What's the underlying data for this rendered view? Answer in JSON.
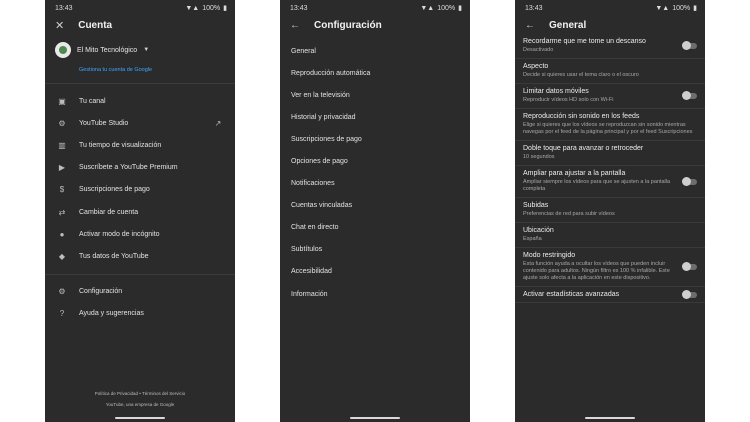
{
  "status": {
    "time": "13:43",
    "battery": "100%"
  },
  "panel1": {
    "title": "Cuenta",
    "account_name": "El Mito Tecnológico",
    "manage_link": "Gestiona tu cuenta de Google",
    "items": [
      {
        "label": "Tu canal",
        "icon": "person-icon"
      },
      {
        "label": "YouTube Studio",
        "icon": "gear-icon"
      },
      {
        "label": "Tu tiempo de visualización",
        "icon": "bar-chart-icon"
      },
      {
        "label": "Suscríbete a YouTube Premium",
        "icon": "youtube-icon"
      },
      {
        "label": "Suscripciones de pago",
        "icon": "dollar-icon"
      },
      {
        "label": "Cambiar de cuenta",
        "icon": "switch-account-icon"
      },
      {
        "label": "Activar modo de incógnito",
        "icon": "incognito-icon"
      },
      {
        "label": "Tus datos de YouTube",
        "icon": "shield-icon"
      }
    ],
    "items2": [
      {
        "label": "Configuración",
        "icon": "gear-icon"
      },
      {
        "label": "Ayuda y sugerencias",
        "icon": "help-icon"
      }
    ],
    "footer_links": "Política de Privacidad  •  Términos del Servicio",
    "footer_company": "YouTube, una empresa de Google"
  },
  "panel2": {
    "title": "Configuración",
    "items": [
      "General",
      "Reproducción automática",
      "Ver en la televisión",
      "Historial y privacidad",
      "Suscripciones de pago",
      "Opciones de pago",
      "Notificaciones",
      "Cuentas vinculadas",
      "Chat en directo",
      "Subtítulos",
      "Accesibilidad",
      "Información"
    ]
  },
  "panel3": {
    "title": "General",
    "settings": [
      {
        "title": "Recordarme que me tome un descanso",
        "subtitle": "Desactivado",
        "toggle": true
      },
      {
        "title": "Aspecto",
        "subtitle": "Decide si quieres usar el tema claro o el oscuro",
        "toggle": false
      },
      {
        "title": "Limitar datos móviles",
        "subtitle": "Reproducir vídeos HD solo con Wi-Fi",
        "toggle": true
      },
      {
        "title": "Reproducción sin sonido en los feeds",
        "subtitle": "Elige si quieres que los vídeos se reproduzcan sin sonido mientras navegas por el feed de la página principal y por el feed Suscripciones",
        "toggle": false
      },
      {
        "title": "Doble toque para avanzar o retroceder",
        "subtitle": "10 segundos",
        "toggle": false
      },
      {
        "title": "Ampliar para ajustar a la pantalla",
        "subtitle": "Ampliar siempre los vídeos para que se ajusten a la pantalla completa",
        "toggle": true
      },
      {
        "title": "Subidas",
        "subtitle": "Preferencias de red para subir vídeos",
        "toggle": false
      },
      {
        "title": "Ubicación",
        "subtitle": "España",
        "toggle": false
      },
      {
        "title": "Modo restringido",
        "subtitle": "Esta función ayuda a ocultar los vídeos que pueden incluir contenido para adultos. Ningún filtro es 100 % infalible. Este ajuste solo afecta a la aplicación en este dispositivo.",
        "toggle": true
      },
      {
        "title": "Activar estadísticas avanzadas",
        "subtitle": "",
        "toggle": true
      }
    ]
  }
}
